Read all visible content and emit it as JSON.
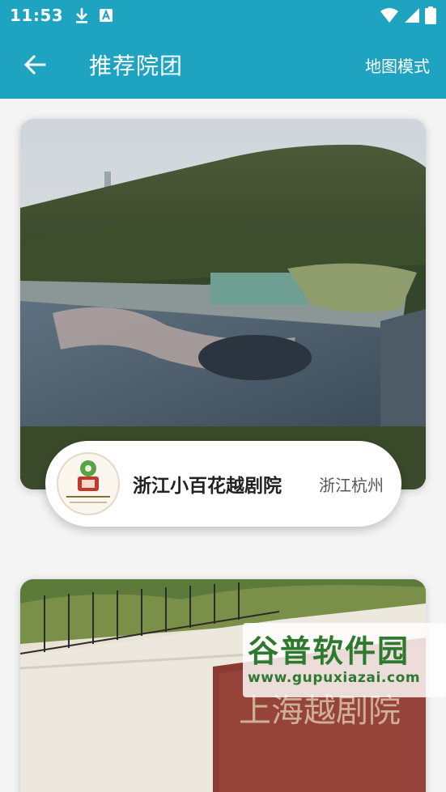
{
  "status_bar": {
    "time": "11:53",
    "left_icons": [
      "download-icon",
      "a-badge-icon"
    ],
    "right_icons": [
      "wifi-icon",
      "signal-icon",
      "battery-icon"
    ]
  },
  "app_bar": {
    "back_icon": "arrow-left-icon",
    "title": "推荐院团",
    "action_label": "地图模式"
  },
  "cards": [
    {
      "name": "浙江小百花越剧院",
      "location": "浙江杭州",
      "logo_text": "浙江小百花越剧院"
    },
    {
      "name": "",
      "location": "",
      "sign_text": "上海越剧院"
    }
  ],
  "watermark": {
    "title": "谷普软件园",
    "url": "www.gupuxiazai.com"
  },
  "colors": {
    "primary": "#1ea3c0",
    "card_bg": "#ffffff",
    "page_bg": "#f4f4f4"
  }
}
